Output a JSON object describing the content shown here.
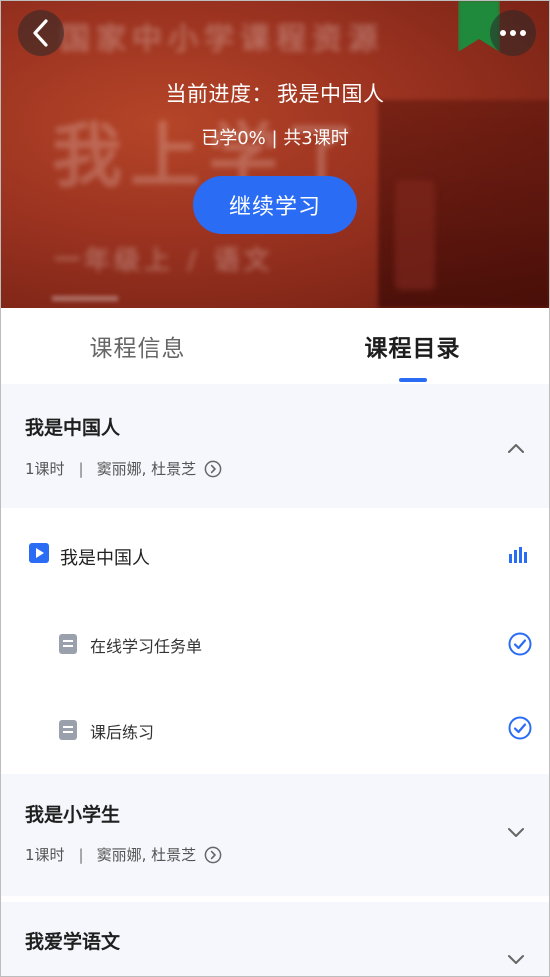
{
  "header": {
    "progress_prefix": "当前进度：",
    "current_lesson": "我是中国人",
    "stats": "已学0% | 共3课时",
    "continue_label": "继续学习",
    "back_icon": "chevron-left-icon",
    "more_icon": "more-dots-icon"
  },
  "tabs": [
    {
      "label": "课程信息",
      "active": false
    },
    {
      "label": "课程目录",
      "active": true
    }
  ],
  "chapters": [
    {
      "title": "我是中国人",
      "hours": "1课时",
      "separator": "|",
      "teachers": "窦丽娜, 杜景芝",
      "expanded": true,
      "items": [
        {
          "type": "video",
          "label": "我是中国人",
          "status": "playing"
        },
        {
          "type": "doc",
          "label": "在线学习任务单",
          "status": "completed"
        },
        {
          "type": "doc",
          "label": "课后练习",
          "status": "completed"
        }
      ]
    },
    {
      "title": "我是小学生",
      "hours": "1课时",
      "separator": "|",
      "teachers": "窦丽娜, 杜景芝",
      "expanded": false
    },
    {
      "title": "我爱学语文",
      "expanded": false
    }
  ],
  "colors": {
    "accent": "#2a6df4",
    "chapter_bg": "#f5f7fc",
    "cover_red": "#9a3220"
  }
}
